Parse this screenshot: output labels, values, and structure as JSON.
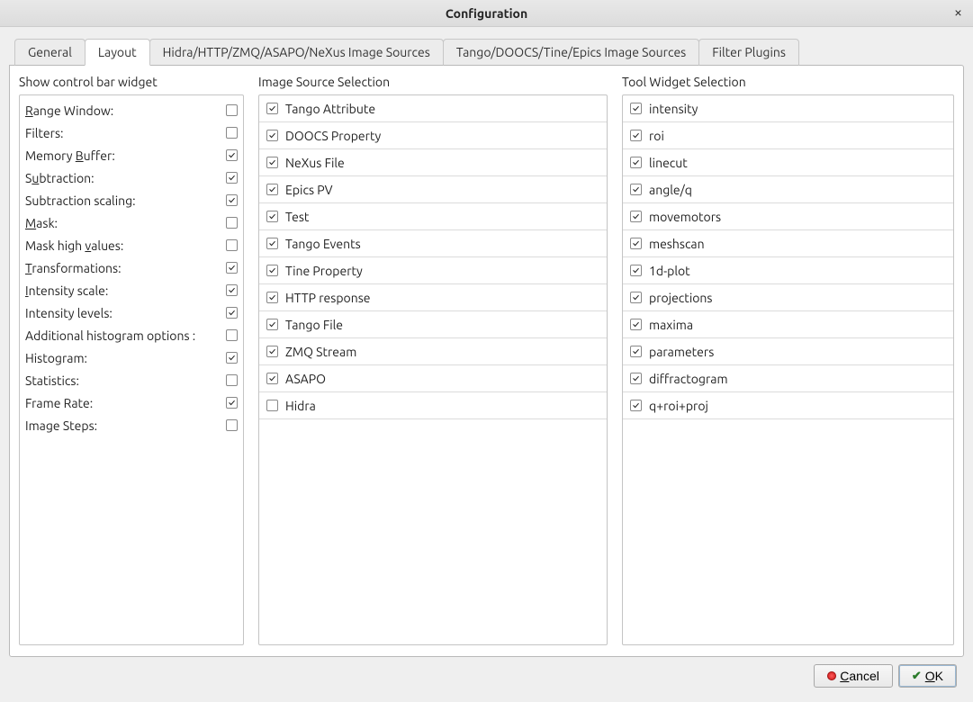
{
  "window": {
    "title": "Configuration",
    "close_label": "×"
  },
  "tabs": [
    {
      "label": "General"
    },
    {
      "label": "Layout"
    },
    {
      "label": "Hidra/HTTP/ZMQ/ASAPO/NeXus Image Sources"
    },
    {
      "label": "Tango/DOOCS/Tine/Epics Image Sources"
    },
    {
      "label": "Filter Plugins"
    }
  ],
  "active_tab_index": 1,
  "sections": {
    "control_bar_title": "Show control bar widget",
    "image_source_title": "Image Source Selection",
    "tool_widget_title": "Tool Widget Selection"
  },
  "control_bar": [
    {
      "label_pre": "",
      "accel": "R",
      "label_post": "ange Window:",
      "checked": false
    },
    {
      "label_pre": "Filters:",
      "accel": "",
      "label_post": "",
      "checked": false
    },
    {
      "label_pre": "Memory ",
      "accel": "B",
      "label_post": "uffer:",
      "checked": true
    },
    {
      "label_pre": "S",
      "accel": "u",
      "label_post": "btraction:",
      "checked": true
    },
    {
      "label_pre": "Subtraction scaling:",
      "accel": "",
      "label_post": "",
      "checked": true
    },
    {
      "label_pre": "",
      "accel": "M",
      "label_post": "ask:",
      "checked": false
    },
    {
      "label_pre": "Mask high ",
      "accel": "v",
      "label_post": "alues:",
      "checked": false
    },
    {
      "label_pre": "",
      "accel": "T",
      "label_post": "ransformations:",
      "checked": true
    },
    {
      "label_pre": "",
      "accel": "I",
      "label_post": "ntensity scale:",
      "checked": true
    },
    {
      "label_pre": "Intensity levels:",
      "accel": "",
      "label_post": "",
      "checked": true
    },
    {
      "label_pre": "Additional histogram options :",
      "accel": "",
      "label_post": "",
      "checked": false
    },
    {
      "label_pre": "Histogram:",
      "accel": "",
      "label_post": "",
      "checked": true
    },
    {
      "label_pre": "Statistics:",
      "accel": "",
      "label_post": "",
      "checked": false
    },
    {
      "label_pre": "Frame Rate:",
      "accel": "",
      "label_post": "",
      "checked": true
    },
    {
      "label_pre": "Image Steps:",
      "accel": "",
      "label_post": "",
      "checked": false
    }
  ],
  "image_sources": [
    {
      "label": "Tango Attribute",
      "checked": true
    },
    {
      "label": "DOOCS Property",
      "checked": true
    },
    {
      "label": "NeXus File",
      "checked": true
    },
    {
      "label": "Epics PV",
      "checked": true
    },
    {
      "label": "Test",
      "checked": true
    },
    {
      "label": "Tango Events",
      "checked": true
    },
    {
      "label": "Tine Property",
      "checked": true
    },
    {
      "label": "HTTP response",
      "checked": true
    },
    {
      "label": "Tango File",
      "checked": true
    },
    {
      "label": "ZMQ Stream",
      "checked": true
    },
    {
      "label": "ASAPO",
      "checked": true
    },
    {
      "label": "Hidra",
      "checked": false
    }
  ],
  "tool_widgets": [
    {
      "label": "intensity",
      "checked": true
    },
    {
      "label": "roi",
      "checked": true
    },
    {
      "label": "linecut",
      "checked": true
    },
    {
      "label": "angle/q",
      "checked": true
    },
    {
      "label": "movemotors",
      "checked": true
    },
    {
      "label": "meshscan",
      "checked": true
    },
    {
      "label": "1d-plot",
      "checked": true
    },
    {
      "label": "projections",
      "checked": true
    },
    {
      "label": "maxima",
      "checked": true
    },
    {
      "label": "parameters",
      "checked": true
    },
    {
      "label": "diffractogram",
      "checked": true
    },
    {
      "label": "q+roi+proj",
      "checked": true
    }
  ],
  "buttons": {
    "cancel_pre": "",
    "cancel_accel": "C",
    "cancel_post": "ancel",
    "ok_pre": "",
    "ok_accel": "O",
    "ok_post": "K"
  }
}
